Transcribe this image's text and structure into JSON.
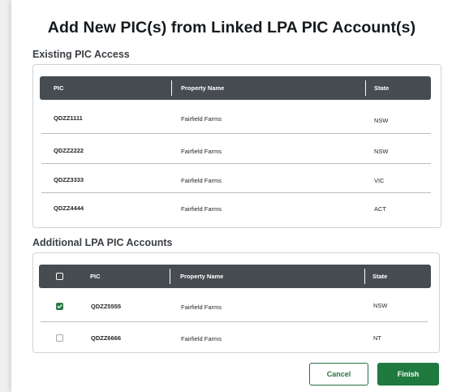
{
  "modal": {
    "title": "Add New PIC(s) from Linked LPA PIC Account(s)"
  },
  "existing": {
    "heading": "Existing PIC Access",
    "columns": {
      "pic": "PIC",
      "property": "Property Name",
      "state": "State"
    },
    "rows": [
      {
        "pic": "QDZZ1111",
        "property": "Fairfield Farms",
        "state": "NSW"
      },
      {
        "pic": "QDZZ2222",
        "property": "Fairfield Farms",
        "state": "NSW"
      },
      {
        "pic": "QDZZ3333",
        "property": "Fairfield Farms",
        "state": "VIC"
      },
      {
        "pic": "QDZZ4444",
        "property": "Fairfield Farms",
        "state": "ACT"
      }
    ]
  },
  "additional": {
    "heading": "Additional LPA PIC Accounts",
    "columns": {
      "pic": "PIC",
      "property": "Property Name",
      "state": "State"
    },
    "select_all_checked": false,
    "rows": [
      {
        "pic": "QDZZ5555",
        "property": "Fairfield Farms",
        "state": "NSW",
        "checked": true
      },
      {
        "pic": "QDZZ6666",
        "property": "Fairfield Farms",
        "state": "NT",
        "checked": false
      }
    ]
  },
  "actions": {
    "cancel_label": "Cancel",
    "finish_label": "Finish"
  },
  "colors": {
    "header_bg": "#474c51",
    "primary_green": "#1e7a3f",
    "check_green": "#2e7a46"
  }
}
